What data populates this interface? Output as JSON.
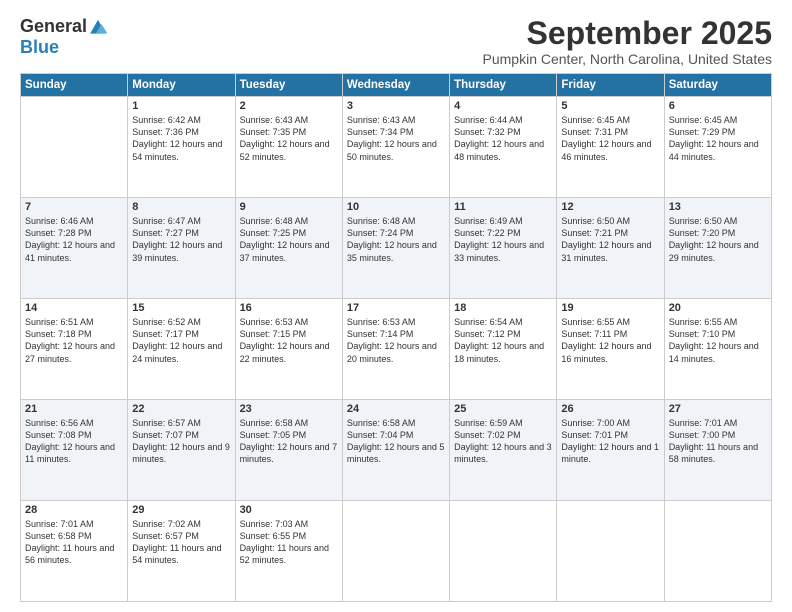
{
  "header": {
    "logo_general": "General",
    "logo_blue": "Blue",
    "month_title": "September 2025",
    "location": "Pumpkin Center, North Carolina, United States"
  },
  "days_of_week": [
    "Sunday",
    "Monday",
    "Tuesday",
    "Wednesday",
    "Thursday",
    "Friday",
    "Saturday"
  ],
  "weeks": [
    [
      {
        "day": "",
        "sunrise": "",
        "sunset": "",
        "daylight": ""
      },
      {
        "day": "1",
        "sunrise": "Sunrise: 6:42 AM",
        "sunset": "Sunset: 7:36 PM",
        "daylight": "Daylight: 12 hours and 54 minutes."
      },
      {
        "day": "2",
        "sunrise": "Sunrise: 6:43 AM",
        "sunset": "Sunset: 7:35 PM",
        "daylight": "Daylight: 12 hours and 52 minutes."
      },
      {
        "day": "3",
        "sunrise": "Sunrise: 6:43 AM",
        "sunset": "Sunset: 7:34 PM",
        "daylight": "Daylight: 12 hours and 50 minutes."
      },
      {
        "day": "4",
        "sunrise": "Sunrise: 6:44 AM",
        "sunset": "Sunset: 7:32 PM",
        "daylight": "Daylight: 12 hours and 48 minutes."
      },
      {
        "day": "5",
        "sunrise": "Sunrise: 6:45 AM",
        "sunset": "Sunset: 7:31 PM",
        "daylight": "Daylight: 12 hours and 46 minutes."
      },
      {
        "day": "6",
        "sunrise": "Sunrise: 6:45 AM",
        "sunset": "Sunset: 7:29 PM",
        "daylight": "Daylight: 12 hours and 44 minutes."
      }
    ],
    [
      {
        "day": "7",
        "sunrise": "Sunrise: 6:46 AM",
        "sunset": "Sunset: 7:28 PM",
        "daylight": "Daylight: 12 hours and 41 minutes."
      },
      {
        "day": "8",
        "sunrise": "Sunrise: 6:47 AM",
        "sunset": "Sunset: 7:27 PM",
        "daylight": "Daylight: 12 hours and 39 minutes."
      },
      {
        "day": "9",
        "sunrise": "Sunrise: 6:48 AM",
        "sunset": "Sunset: 7:25 PM",
        "daylight": "Daylight: 12 hours and 37 minutes."
      },
      {
        "day": "10",
        "sunrise": "Sunrise: 6:48 AM",
        "sunset": "Sunset: 7:24 PM",
        "daylight": "Daylight: 12 hours and 35 minutes."
      },
      {
        "day": "11",
        "sunrise": "Sunrise: 6:49 AM",
        "sunset": "Sunset: 7:22 PM",
        "daylight": "Daylight: 12 hours and 33 minutes."
      },
      {
        "day": "12",
        "sunrise": "Sunrise: 6:50 AM",
        "sunset": "Sunset: 7:21 PM",
        "daylight": "Daylight: 12 hours and 31 minutes."
      },
      {
        "day": "13",
        "sunrise": "Sunrise: 6:50 AM",
        "sunset": "Sunset: 7:20 PM",
        "daylight": "Daylight: 12 hours and 29 minutes."
      }
    ],
    [
      {
        "day": "14",
        "sunrise": "Sunrise: 6:51 AM",
        "sunset": "Sunset: 7:18 PM",
        "daylight": "Daylight: 12 hours and 27 minutes."
      },
      {
        "day": "15",
        "sunrise": "Sunrise: 6:52 AM",
        "sunset": "Sunset: 7:17 PM",
        "daylight": "Daylight: 12 hours and 24 minutes."
      },
      {
        "day": "16",
        "sunrise": "Sunrise: 6:53 AM",
        "sunset": "Sunset: 7:15 PM",
        "daylight": "Daylight: 12 hours and 22 minutes."
      },
      {
        "day": "17",
        "sunrise": "Sunrise: 6:53 AM",
        "sunset": "Sunset: 7:14 PM",
        "daylight": "Daylight: 12 hours and 20 minutes."
      },
      {
        "day": "18",
        "sunrise": "Sunrise: 6:54 AM",
        "sunset": "Sunset: 7:12 PM",
        "daylight": "Daylight: 12 hours and 18 minutes."
      },
      {
        "day": "19",
        "sunrise": "Sunrise: 6:55 AM",
        "sunset": "Sunset: 7:11 PM",
        "daylight": "Daylight: 12 hours and 16 minutes."
      },
      {
        "day": "20",
        "sunrise": "Sunrise: 6:55 AM",
        "sunset": "Sunset: 7:10 PM",
        "daylight": "Daylight: 12 hours and 14 minutes."
      }
    ],
    [
      {
        "day": "21",
        "sunrise": "Sunrise: 6:56 AM",
        "sunset": "Sunset: 7:08 PM",
        "daylight": "Daylight: 12 hours and 11 minutes."
      },
      {
        "day": "22",
        "sunrise": "Sunrise: 6:57 AM",
        "sunset": "Sunset: 7:07 PM",
        "daylight": "Daylight: 12 hours and 9 minutes."
      },
      {
        "day": "23",
        "sunrise": "Sunrise: 6:58 AM",
        "sunset": "Sunset: 7:05 PM",
        "daylight": "Daylight: 12 hours and 7 minutes."
      },
      {
        "day": "24",
        "sunrise": "Sunrise: 6:58 AM",
        "sunset": "Sunset: 7:04 PM",
        "daylight": "Daylight: 12 hours and 5 minutes."
      },
      {
        "day": "25",
        "sunrise": "Sunrise: 6:59 AM",
        "sunset": "Sunset: 7:02 PM",
        "daylight": "Daylight: 12 hours and 3 minutes."
      },
      {
        "day": "26",
        "sunrise": "Sunrise: 7:00 AM",
        "sunset": "Sunset: 7:01 PM",
        "daylight": "Daylight: 12 hours and 1 minute."
      },
      {
        "day": "27",
        "sunrise": "Sunrise: 7:01 AM",
        "sunset": "Sunset: 7:00 PM",
        "daylight": "Daylight: 11 hours and 58 minutes."
      }
    ],
    [
      {
        "day": "28",
        "sunrise": "Sunrise: 7:01 AM",
        "sunset": "Sunset: 6:58 PM",
        "daylight": "Daylight: 11 hours and 56 minutes."
      },
      {
        "day": "29",
        "sunrise": "Sunrise: 7:02 AM",
        "sunset": "Sunset: 6:57 PM",
        "daylight": "Daylight: 11 hours and 54 minutes."
      },
      {
        "day": "30",
        "sunrise": "Sunrise: 7:03 AM",
        "sunset": "Sunset: 6:55 PM",
        "daylight": "Daylight: 11 hours and 52 minutes."
      },
      {
        "day": "",
        "sunrise": "",
        "sunset": "",
        "daylight": ""
      },
      {
        "day": "",
        "sunrise": "",
        "sunset": "",
        "daylight": ""
      },
      {
        "day": "",
        "sunrise": "",
        "sunset": "",
        "daylight": ""
      },
      {
        "day": "",
        "sunrise": "",
        "sunset": "",
        "daylight": ""
      }
    ]
  ]
}
